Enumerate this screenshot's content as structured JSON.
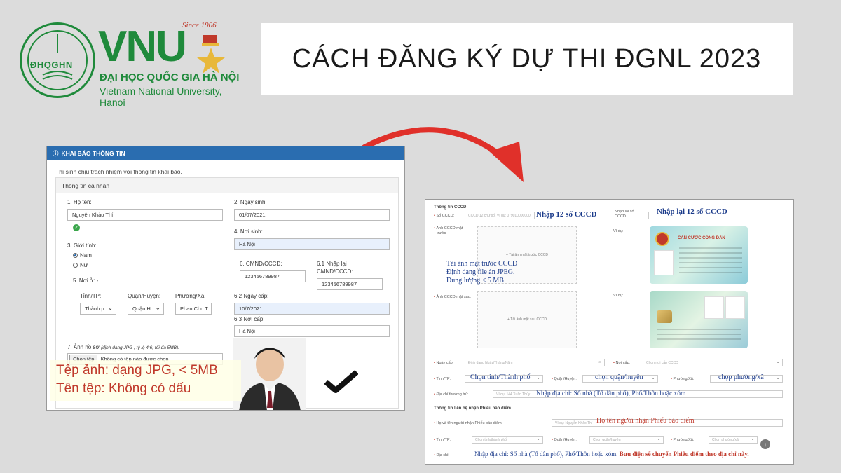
{
  "logo": {
    "circle_text": "ĐHQGHN",
    "since": "Since 1906",
    "brand": "VNU",
    "name_vi": "ĐẠI HỌC QUỐC GIA HÀ NỘI",
    "name_en": "Vietnam National University, Hanoi"
  },
  "title": "CÁCH ĐĂNG KÝ DỰ THI ĐGNL 2023",
  "left_form": {
    "header": "KHAI BÁO THÔNG TIN",
    "note": "Thí sinh chịu trách nhiệm với thông tin khai báo.",
    "panel_title": "Thông tin cá nhân",
    "fields": {
      "name_label": "1. Họ tên:",
      "name_value": "Nguyễn Khảo Thí",
      "dob_label": "2. Ngày sinh:",
      "dob_value": "01/07/2021",
      "gender_label": "3. Giới tính:",
      "gender_male": "Nam",
      "gender_female": "Nữ",
      "birthplace_label": "4. Nơi sinh:",
      "birthplace_value": "Hà Nội",
      "residence_label": "5. Nơi ở: -",
      "id_label": "6. CMND/CCCD:",
      "id_value": "123456789987",
      "id_confirm_label_1": "6.1 Nhập lại",
      "id_confirm_label_2": "CMND/CCCD:",
      "id_confirm_value": "123456789987",
      "province_label": "Tỉnh/TP:",
      "province_value": "Thành p",
      "district_label": "Quận/Huyện:",
      "district_value": "Quận H",
      "ward_label": "Phường/Xã:",
      "ward_value": "Phan Chu T",
      "issue_date_label": "6.2 Ngày cấp:",
      "issue_date_value": "10/7/2021",
      "issue_place_label": "6.3 Nơi cấp:",
      "issue_place_value": "Hà Nội",
      "photo_label": "7. Ảnh hồ sơ",
      "photo_hint": "(định dạng JPG , tỷ lệ 4:6, tối đa 5MB):",
      "choose_file": "Chọn tệp",
      "no_file": "Không có tệp nào được chọn"
    },
    "overlay_line1": "Tệp ảnh: dạng JPG, < 5MB",
    "overlay_line2": "Tên tệp: Không có dấu"
  },
  "right_form": {
    "section_cccd": "Thông tin CCCD",
    "cccd_label": "Số CCCD:",
    "cccd_placeholder": "CCCD 12 chữ số. Ví dụ: 079010000000",
    "cccd_note": "Nhập 12 số CCCD",
    "cccd_confirm_label_1": "Nhập lại số",
    "cccd_confirm_label_2": "CCCD",
    "cccd_confirm_note": "Nhập lại 12 số CCCD",
    "front_label_1": "Ảnh CCCD mặt",
    "front_label_2": "trước",
    "front_upload": "+ Tải ảnh mặt trước CCCD",
    "front_note_1": "Tải ảnh mặt trước CCCD",
    "front_note_2": "Định dạng file ản JPEG.",
    "front_note_3": "Dung lượng < 5 MB",
    "example_label": "Ví dụ:",
    "card_title": "CĂN CƯỚC CÔNG DÂN",
    "back_label": "Ảnh CCCD mặt sau:",
    "back_upload": "+ Tải ảnh mặt sau CCCD",
    "issue_date_label": "Ngày cấp:",
    "issue_date_placeholder": "Định dạng Ngày/Tháng/Năm",
    "issue_place_label": "Nơi cấp:",
    "issue_place_placeholder": "Chọn nơi cấp CCCD",
    "province_label": "Tỉnh/TP:",
    "province_note": "Chọn tỉnh/Thành phố",
    "district_label": "Quận/Huyện:",
    "district_note": "chọn quận/huyện",
    "ward_label": "Phường/Xã:",
    "ward_note": "chọp phường/xã",
    "address_label": "Địa chỉ thường trú:",
    "address_placeholder": "Ví dụ: 144 Xuân Thủy",
    "address_note": "Nhập địa chỉ: Số nhà (Tổ dân phố), Phố/Thôn hoặc xóm",
    "section_contact": "Thông tin liên hệ nhận Phiếu báo điểm",
    "receiver_label": "Họ và tên người nhận Phiếu báo điểm:",
    "receiver_placeholder": "Ví dụ: Nguyễn Khảo Thí",
    "receiver_note": "Họ tên người nhận Phiếu báo điểm",
    "c_province_label": "Tỉnh/TP:",
    "c_province_placeholder": "Chọn tỉnh/thành phố",
    "c_district_label": "Quận/Huyện:",
    "c_district_placeholder": "Chọn quận/huyện",
    "c_ward_label": "Phường/Xã:",
    "c_ward_placeholder": "Chọn phường/xã",
    "c_address_label": "Địa chỉ:",
    "c_address_note": "Nhập địa chỉ: Số nhà (Tổ dân phố), Phố/Thôn hoặc xóm.",
    "c_address_note_red": "Bưu điện sẽ chuyển Phiếu điểm theo địa chỉ này."
  },
  "colors": {
    "brand_green": "#1f8a3b",
    "header_blue": "#2a6db0",
    "note_red": "#c0392b",
    "arrow_red": "#e0302a"
  }
}
